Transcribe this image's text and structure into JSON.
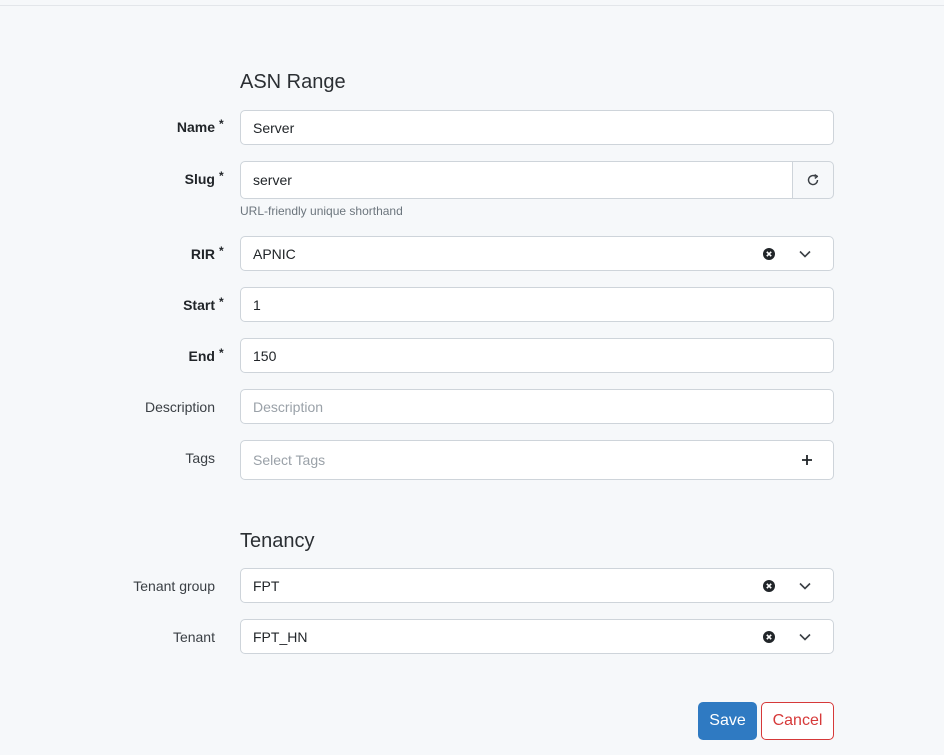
{
  "form": {
    "sections": {
      "asn_range": "ASN Range",
      "tenancy": "Tenancy"
    },
    "fields": {
      "name": {
        "label": "Name",
        "value": "Server"
      },
      "slug": {
        "label": "Slug",
        "value": "server",
        "help": "URL-friendly unique shorthand"
      },
      "rir": {
        "label": "RIR",
        "value": "APNIC"
      },
      "start": {
        "label": "Start",
        "value": "1"
      },
      "end": {
        "label": "End",
        "value": "150"
      },
      "description": {
        "label": "Description",
        "placeholder": "Description"
      },
      "tags": {
        "label": "Tags",
        "placeholder": "Select Tags"
      },
      "tenant_group": {
        "label": "Tenant group",
        "value": "FPT"
      },
      "tenant": {
        "label": "Tenant",
        "value": "FPT_HN"
      }
    },
    "required_marker": "*",
    "buttons": {
      "save": "Save",
      "cancel": "Cancel"
    }
  },
  "icons": {
    "slug_regenerate": "refresh-icon",
    "clear": "clear-icon",
    "dropdown": "chevron-down-icon",
    "add": "plus-icon"
  },
  "colors": {
    "primary": "#2f7ac2",
    "danger": "#d63939",
    "background": "#f6f8fa",
    "border": "#ced4da"
  }
}
